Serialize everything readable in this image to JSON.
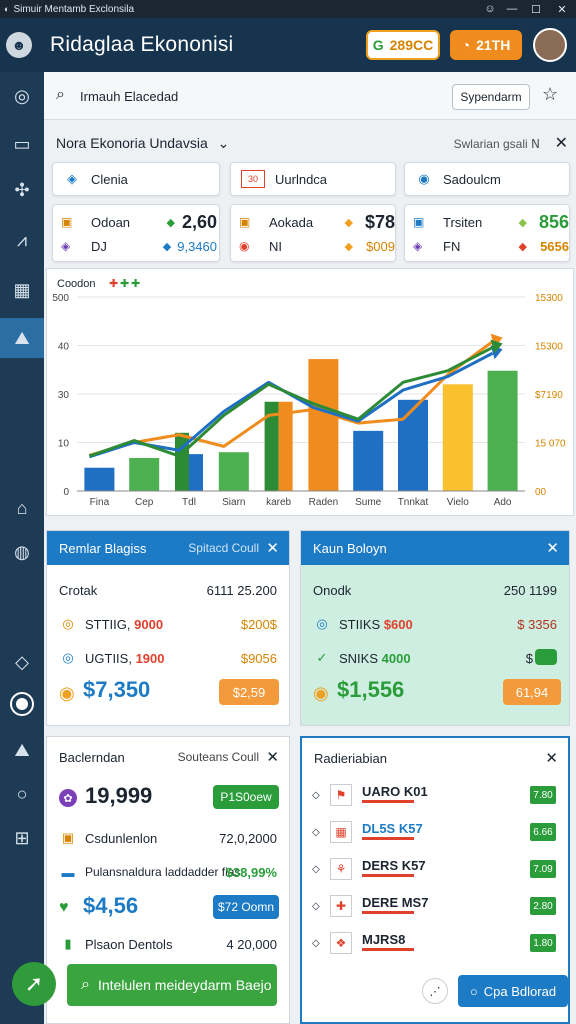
{
  "window": {
    "title": "Simuir Mentamb Exclonsila",
    "controls": [
      "▾",
      "—",
      "☐",
      "✕"
    ]
  },
  "header": {
    "title": "Ridaglaa Ekononisi",
    "badge1": "289CC",
    "badge1_icon": "G",
    "badge2": "21TH"
  },
  "search": {
    "placeholder": "Irmauh Elacedad",
    "button": "Sypendarm"
  },
  "panel": {
    "title": "Nora Ekonoria Undavsia",
    "right": "Swlarian gsali"
  },
  "tabs": [
    {
      "icon": "◈",
      "label": "Clenia"
    },
    {
      "icon": "30",
      "label": "Uurlndca"
    },
    {
      "icon": "◉",
      "label": "Sadoulcm"
    }
  ],
  "stats": [
    {
      "rows": [
        {
          "icon": "▣",
          "label": "Odoan",
          "marker": "◆",
          "marker_color": "#2a9d3a",
          "value": "2,60"
        },
        {
          "icon": "◈",
          "label": "DJ",
          "marker": "◆",
          "marker_color": "#1d7bc6",
          "value": "9,3460"
        }
      ]
    },
    {
      "rows": [
        {
          "icon": "▣",
          "label": "Aokada",
          "marker": "◆",
          "marker_color": "#f0a020",
          "value": "$78"
        },
        {
          "icon": "◉",
          "label": "NI",
          "marker": "◆",
          "marker_color": "#f0a020",
          "value": "$009"
        }
      ]
    },
    {
      "rows": [
        {
          "icon": "▣",
          "label": "Trsiten",
          "marker": "◆",
          "marker_color": "#8bc34a",
          "value": "856"
        },
        {
          "icon": "◈",
          "label": "FN",
          "marker": "◆",
          "marker_color": "#e0412c",
          "value": "5656"
        }
      ]
    }
  ],
  "chart_data": {
    "type": "bar",
    "title": "Coodon",
    "categories": [
      "Fina",
      "Cep",
      "Tdl",
      "Siarn",
      "kareb",
      "Raden",
      "Sume",
      "Tnnkat",
      "Vielo",
      "Ado"
    ],
    "ylim": [
      0,
      500
    ],
    "yticks_left": [
      "0",
      "10",
      "30",
      "40",
      "500"
    ],
    "yticks_right": [
      "00",
      "15 070",
      "$7190",
      "15300",
      "15300"
    ],
    "bars": [
      {
        "value": 60,
        "color": "#1f6fc4"
      },
      {
        "value": 85,
        "color": "#4caf50"
      },
      {
        "value": 150,
        "color": "#2e8b35",
        "value2": 95,
        "color2": "#1f6fc4"
      },
      {
        "value": 100,
        "color": "#4caf50"
      },
      {
        "value": 230,
        "color": "#2e8b35",
        "value2": 230,
        "color2": "#f08c1e"
      },
      {
        "value": 340,
        "color": "#f08c1e"
      },
      {
        "value": 155,
        "color": "#1f6fc4"
      },
      {
        "value": 235,
        "color": "#1f6fc4"
      },
      {
        "value": 275,
        "color": "#fbc02d"
      },
      {
        "value": 310,
        "color": "#4caf50"
      }
    ],
    "series": [
      {
        "color": "#f08c1e",
        "values": [
          92,
          125,
          145,
          115,
          195,
          210,
          175,
          185,
          300,
          385
        ]
      },
      {
        "color": "#1f6fc4",
        "values": [
          88,
          125,
          105,
          205,
          280,
          215,
          180,
          260,
          295,
          355
        ]
      },
      {
        "color": "#2e8b35",
        "values": [
          90,
          130,
          90,
          195,
          275,
          225,
          185,
          280,
          310,
          370
        ]
      }
    ]
  },
  "box1": {
    "title": "Remlar Blagiss",
    "right": "Spitacd Coull",
    "head_label": "Crotak",
    "head_value": "6111 25.200",
    "rows": [
      {
        "icon": "◎",
        "label": "STTIIG,",
        "accent": "9000",
        "accent_color": "#e0412c",
        "value": "$200$"
      },
      {
        "icon": "◎",
        "label": "UGTIIS,",
        "accent": "1900",
        "accent_color": "#e0412c",
        "value": "$9056"
      }
    ],
    "big": "$7,350",
    "tag": "$2,59"
  },
  "box2": {
    "title": "Kaun Boloyn",
    "head_label": "Onodk",
    "head_value": "250 1199",
    "rows": [
      {
        "icon": "◎",
        "label": "STIIKS",
        "accent": "$600",
        "accent_color": "#e0412c",
        "value": "$ 3356"
      },
      {
        "icon": "✓",
        "label": "SNIKS",
        "accent": "4000",
        "accent_color": "#2a9d3a",
        "value": "$"
      }
    ],
    "big": "$1,556",
    "tag": "61,94"
  },
  "box3": {
    "title": "Baclerndan",
    "right": "Souteans Coull",
    "big": "19,999",
    "big_tag": "P1S0oew",
    "rows": [
      {
        "icon": "▣",
        "label": "Csdunlenlon",
        "value": "72,0,2000"
      },
      {
        "icon": "▬",
        "label": "Pulansnaldura laddadder fias",
        "value": "$38,99%"
      }
    ],
    "big2": "$4,56",
    "big2_tag": "$72 Oomn",
    "foot_label": "Plsaon Dentols",
    "foot_value": "4 20,000"
  },
  "box4": {
    "title": "Radieriabian",
    "items": [
      {
        "icon": "⚑",
        "label": "UARO K01",
        "color": "#1c2530",
        "tag": "7.80"
      },
      {
        "icon": "▦",
        "label": "DL5S K57",
        "color": "#1d7bc6",
        "tag": "6.66"
      },
      {
        "icon": "⚘",
        "label": "DERS K57",
        "color": "#1c2530",
        "tag": "7.09"
      },
      {
        "icon": "✚",
        "label": "DERE MS7",
        "color": "#1c2530",
        "tag": "2.80"
      },
      {
        "icon": "❖",
        "label": "MJRS8",
        "color": "#1c2530",
        "tag": "1.80"
      }
    ]
  },
  "bottom": {
    "cta": "Intelulen meideydarm Baejo",
    "cta_icon": "⌕",
    "dots": "⋰",
    "cpa": "Cpa Bdlorad",
    "cpa_icon": "○"
  }
}
